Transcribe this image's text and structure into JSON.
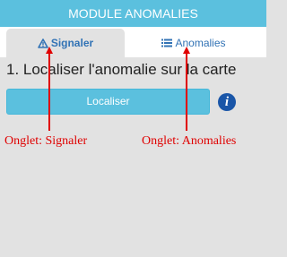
{
  "header": {
    "title": "MODULE ANOMALIES"
  },
  "tabs": [
    {
      "label": "Signaler",
      "icon": "warning-triangle-icon",
      "active": true
    },
    {
      "label": "Anomalies",
      "icon": "list-icon",
      "active": false
    }
  ],
  "step": {
    "title": "1. Localiser l'anomalie sur la carte"
  },
  "locate_button": {
    "label": "Localiser"
  },
  "info_icon": {
    "glyph": "i"
  },
  "annotations": [
    {
      "text": "Onglet:  Signaler"
    },
    {
      "text": "Onglet:  Anomalies"
    }
  ],
  "colors": {
    "accent": "#5bc0de",
    "tab_text": "#3273b5",
    "annotation": "#e00000",
    "info": "#1a56a8",
    "background": "#e2e2e2"
  }
}
